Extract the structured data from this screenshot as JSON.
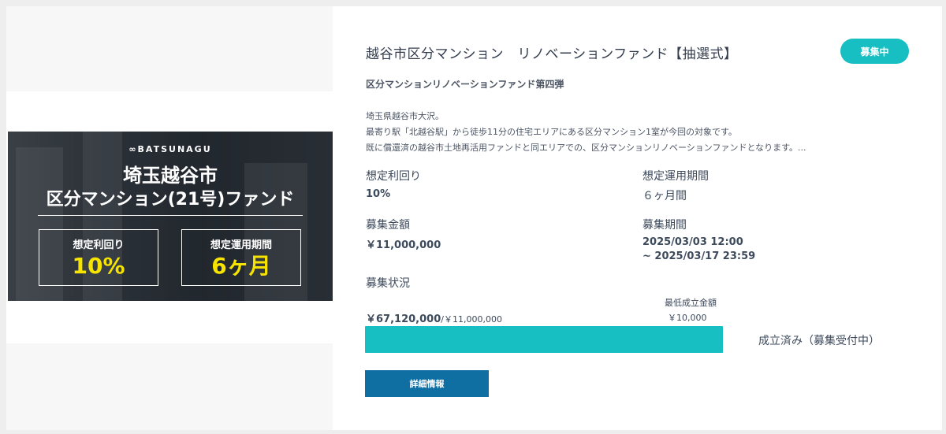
{
  "banner": {
    "brand": "∞BATSUNAGU",
    "line1": "埼玉越谷市",
    "line2": "区分マンション(21号)ファンド",
    "box1_label": "想定利回り",
    "box1_value": "10%",
    "box2_label": "想定運用期間",
    "box2_value": "6ヶ月"
  },
  "fund": {
    "title": "越谷市区分マンション　リノベーションファンド【抽選式】",
    "status": "募集中",
    "subtitle": "区分マンションリノベーションファンド第四弾",
    "description": [
      "埼玉県越谷市大沢。",
      "最寄り駅「北越谷駅」から徒歩11分の住宅エリアにある区分マンション1室が今回の対象です。",
      "既に償還済の越谷市土地再活用ファンドと同エリアでの、区分マンションリノベーションファンドとなります。..."
    ]
  },
  "fields": {
    "yield_label": "想定利回り",
    "yield_value": "10%",
    "period_label": "想定運用期間",
    "period_value": "６ヶ月間",
    "amount_label": "募集金額",
    "amount_value": "￥11,000,000",
    "recruit_period_label": "募集期間",
    "recruit_start": "2025/03/03 12:00",
    "recruit_end": "~ 2025/03/17 23:59",
    "status_label": "募集状況"
  },
  "progress": {
    "raised": "￥67,120,000",
    "target": "/￥11,000,000",
    "min_label": "最低成立金額",
    "min_value": "￥10,000",
    "percent": 100,
    "result": "成立済み（募集受付中）"
  },
  "buttons": {
    "detail": "詳細情報"
  },
  "colors": {
    "accent": "#18bfc2",
    "button": "#0f6fa3",
    "banner_highlight": "#f6e400"
  }
}
